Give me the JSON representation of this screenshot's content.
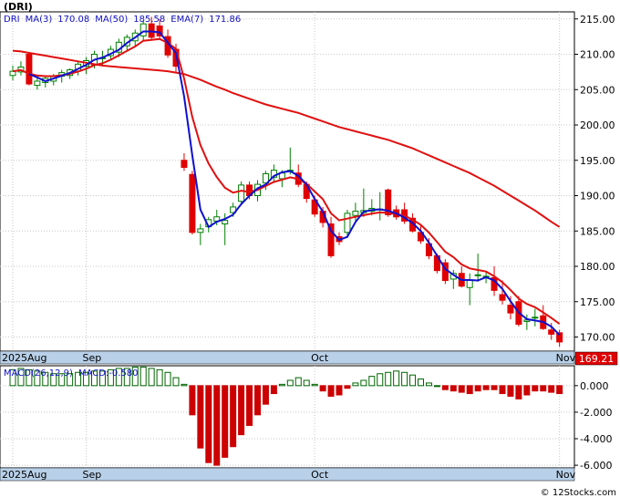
{
  "header": {
    "ticker_title": "(DRI)"
  },
  "legend_price": [
    {
      "text": "DRI",
      "color": "#1010c0"
    },
    {
      "text": "MA(3)",
      "color": "#1010c0"
    },
    {
      "text": "170.08",
      "color": "#1010c0"
    },
    {
      "text": "MA(50)",
      "color": "#1010c0"
    },
    {
      "text": "185.58",
      "color": "#1010c0"
    },
    {
      "text": "EMA(7)",
      "color": "#1010c0"
    },
    {
      "text": "171.86",
      "color": "#1010c0"
    }
  ],
  "legend_macd": [
    {
      "text": "MACD(26,12,9)",
      "color": "#1010c0"
    },
    {
      "text": "MACD:-0.580",
      "color": "#1010c0"
    }
  ],
  "last_price_label": "169.21",
  "watermark": "© 12Stocks.com",
  "colors": {
    "up": "#008000",
    "down": "#e00000",
    "ma3": "#1010d0",
    "ma50": "#e01010",
    "ema7": "#e01010",
    "hist": "#cc0000",
    "hist_up": "#006400",
    "axisbar": "#b8d0e8"
  },
  "chart_data": [
    {
      "type": "candlestick",
      "title": "DRI",
      "ylim": [
        168,
        216
      ],
      "yticks": [
        170,
        175,
        180,
        185,
        190,
        195,
        200,
        205,
        210,
        215
      ],
      "ytick_labels": [
        "170.00",
        "175.00",
        "180.00",
        "185.00",
        "190.00",
        "195.00",
        "200.00",
        "205.00",
        "210.00",
        "215.00"
      ],
      "xtick_labels": [
        {
          "label": "2025Aug",
          "bar": 0
        },
        {
          "label": "Sep",
          "bar": 9
        },
        {
          "label": "Oct",
          "bar": 37
        },
        {
          "label": "Nov",
          "bar": 67
        }
      ],
      "ohlc": [
        [
          207.0,
          208.4,
          206.3,
          207.6
        ],
        [
          207.5,
          209.0,
          207.0,
          208.2
        ],
        [
          210.0,
          210.2,
          205.6,
          205.8
        ],
        [
          205.6,
          206.8,
          205.0,
          206.2
        ],
        [
          206.0,
          207.0,
          205.3,
          206.6
        ],
        [
          206.2,
          207.2,
          205.6,
          206.9
        ],
        [
          206.9,
          207.8,
          206.0,
          207.4
        ],
        [
          207.0,
          208.0,
          206.5,
          207.8
        ],
        [
          207.6,
          209.0,
          207.0,
          208.6
        ],
        [
          208.3,
          209.6,
          207.2,
          209.1
        ],
        [
          208.5,
          210.5,
          208.0,
          210.0
        ],
        [
          209.5,
          210.5,
          208.5,
          209.5
        ],
        [
          209.8,
          211.2,
          209.2,
          210.7
        ],
        [
          210.3,
          212.2,
          209.6,
          211.7
        ],
        [
          211.2,
          212.8,
          210.5,
          212.4
        ],
        [
          211.9,
          213.5,
          211.0,
          213.0
        ],
        [
          212.6,
          214.8,
          212.0,
          214.3
        ],
        [
          214.3,
          215.3,
          212.0,
          212.4
        ],
        [
          214.0,
          215.0,
          212.0,
          212.6
        ],
        [
          212.5,
          213.5,
          209.5,
          209.9
        ],
        [
          210.7,
          211.5,
          207.5,
          208.3
        ],
        [
          195.0,
          196.0,
          193.5,
          194.0
        ],
        [
          193.0,
          193.5,
          184.5,
          184.8
        ],
        [
          184.8,
          186.0,
          183.0,
          185.3
        ],
        [
          185.6,
          187.0,
          184.8,
          186.6
        ],
        [
          186.4,
          188.0,
          185.8,
          187.0
        ],
        [
          186.0,
          187.5,
          183.0,
          186.5
        ],
        [
          187.6,
          189.0,
          187.0,
          188.4
        ],
        [
          189.2,
          192.0,
          188.8,
          191.5
        ],
        [
          191.5,
          192.0,
          189.5,
          190.0
        ],
        [
          190.0,
          192.2,
          189.2,
          191.6
        ],
        [
          191.8,
          193.5,
          190.8,
          193.1
        ],
        [
          192.6,
          194.4,
          191.8,
          193.6
        ],
        [
          192.4,
          193.6,
          191.2,
          193.2
        ],
        [
          193.5,
          196.8,
          193.0,
          193.6
        ],
        [
          193.2,
          194.4,
          191.2,
          191.6
        ],
        [
          191.6,
          192.0,
          189.0,
          189.6
        ],
        [
          189.4,
          190.0,
          187.0,
          187.4
        ],
        [
          187.8,
          188.4,
          185.5,
          186.2
        ],
        [
          186.0,
          187.0,
          181.2,
          181.5
        ],
        [
          184.2,
          184.8,
          183.0,
          183.5
        ],
        [
          184.8,
          188.0,
          184.0,
          187.5
        ],
        [
          187.2,
          189.0,
          186.2,
          187.8
        ],
        [
          187.6,
          191.0,
          187.0,
          187.9
        ],
        [
          187.8,
          189.5,
          187.2,
          188.2
        ],
        [
          188.0,
          190.5,
          186.5,
          188.1
        ],
        [
          190.8,
          191.0,
          187.0,
          187.3
        ],
        [
          188.0,
          188.6,
          186.6,
          187.0
        ],
        [
          188.0,
          189.0,
          186.0,
          186.4
        ],
        [
          186.8,
          187.5,
          184.8,
          185.0
        ],
        [
          184.8,
          185.8,
          183.2,
          183.6
        ],
        [
          183.2,
          184.0,
          181.0,
          181.5
        ],
        [
          181.5,
          181.8,
          179.0,
          179.4
        ],
        [
          180.5,
          181.0,
          177.5,
          178.0
        ],
        [
          178.2,
          179.5,
          176.8,
          179.0
        ],
        [
          179.0,
          180.0,
          177.0,
          177.2
        ],
        [
          177.0,
          179.0,
          174.5,
          178.0
        ],
        [
          178.8,
          181.8,
          177.8,
          178.8
        ],
        [
          178.6,
          179.2,
          177.6,
          178.6
        ],
        [
          178.4,
          180.0,
          175.8,
          176.6
        ],
        [
          176.0,
          178.0,
          174.6,
          175.2
        ],
        [
          174.5,
          175.8,
          172.5,
          173.4
        ],
        [
          175.0,
          175.8,
          171.5,
          171.8
        ],
        [
          172.2,
          173.2,
          171.0,
          172.4
        ],
        [
          172.7,
          174.0,
          171.5,
          172.8
        ],
        [
          173.0,
          174.5,
          171.0,
          171.2
        ],
        [
          171.0,
          172.0,
          169.6,
          170.4
        ],
        [
          170.6,
          171.0,
          168.6,
          169.3
        ]
      ],
      "series": [
        {
          "name": "MA(3)",
          "values": [
            null,
            null,
            207.2,
            206.73,
            206.2,
            206.57,
            206.97,
            207.37,
            207.93,
            208.5,
            209.23,
            209.53,
            210.07,
            210.63,
            211.6,
            212.37,
            213.23,
            213.23,
            213.1,
            211.63,
            210.2,
            204.07,
            195.7,
            188.03,
            185.57,
            186.3,
            186.7,
            187.3,
            188.8,
            189.97,
            191.03,
            191.57,
            192.77,
            193.3,
            193.47,
            192.8,
            191.6,
            189.53,
            187.73,
            185.03,
            183.73,
            184.17,
            186.27,
            187.73,
            187.97,
            188.07,
            187.87,
            187.47,
            186.9,
            186.13,
            185.0,
            183.37,
            181.5,
            179.63,
            178.8,
            178.07,
            178.07,
            178.0,
            178.47,
            178.0,
            176.8,
            175.07,
            173.47,
            172.53,
            172.33,
            172.13,
            171.47,
            170.3
          ]
        },
        {
          "name": "EMA(7)",
          "values": [
            207.6,
            207.75,
            207.26,
            207.0,
            206.9,
            206.9,
            207.03,
            207.22,
            207.56,
            207.94,
            208.45,
            208.72,
            209.22,
            209.84,
            210.48,
            211.11,
            211.91,
            212.03,
            212.17,
            211.6,
            210.77,
            206.58,
            201.13,
            197.17,
            194.53,
            192.65,
            191.11,
            190.43,
            190.7,
            190.53,
            190.8,
            191.38,
            191.94,
            192.25,
            192.59,
            192.34,
            191.66,
            190.6,
            189.5,
            187.5,
            186.5,
            186.75,
            187.01,
            187.23,
            187.47,
            187.63,
            187.55,
            187.41,
            187.16,
            186.62,
            185.87,
            184.78,
            183.43,
            182.07,
            181.3,
            180.27,
            179.7,
            179.48,
            179.26,
            178.6,
            177.75,
            176.66,
            175.45,
            174.69,
            174.22,
            173.47,
            172.7,
            171.86
          ]
        },
        {
          "name": "MA(50)",
          "values": [
            210.5,
            210.4,
            210.2,
            210.0,
            209.8,
            209.6,
            209.4,
            209.2,
            209.0,
            208.8,
            208.6,
            208.4,
            208.3,
            208.2,
            208.1,
            208.0,
            207.9,
            207.8,
            207.7,
            207.6,
            207.4,
            207.2,
            206.8,
            206.4,
            205.9,
            205.4,
            205.0,
            204.5,
            204.1,
            203.7,
            203.3,
            202.9,
            202.6,
            202.3,
            202.0,
            201.7,
            201.3,
            200.9,
            200.5,
            200.1,
            199.7,
            199.4,
            199.1,
            198.8,
            198.5,
            198.2,
            197.9,
            197.5,
            197.1,
            196.7,
            196.2,
            195.7,
            195.2,
            194.7,
            194.2,
            193.7,
            193.2,
            192.6,
            192.0,
            191.4,
            190.7,
            190.0,
            189.3,
            188.6,
            187.9,
            187.1,
            186.3,
            185.58
          ]
        }
      ]
    },
    {
      "type": "histogram",
      "title": "MACD(26,12,9)",
      "ylim": [
        -6.2,
        1.5
      ],
      "yticks": [
        0,
        -2,
        -4,
        -6
      ],
      "ytick_labels": [
        "0.000",
        "-2.000",
        "-4.000",
        "-6.000"
      ],
      "xtick_labels": [
        {
          "label": "2025Aug",
          "bar": 0
        },
        {
          "label": "Sep",
          "bar": 9
        },
        {
          "label": "Oct",
          "bar": 37
        },
        {
          "label": "Nov",
          "bar": 67
        }
      ],
      "values": [
        1.2,
        1.3,
        1.2,
        1.1,
        1.0,
        0.9,
        0.9,
        0.9,
        1.0,
        1.0,
        1.1,
        1.1,
        1.2,
        1.3,
        1.3,
        1.4,
        1.4,
        1.3,
        1.2,
        1.0,
        0.6,
        0.1,
        -2.2,
        -4.7,
        -5.8,
        -6.0,
        -5.4,
        -4.6,
        -3.7,
        -3.0,
        -2.2,
        -1.4,
        -0.6,
        0.1,
        0.4,
        0.6,
        0.4,
        0.1,
        -0.4,
        -0.8,
        -0.7,
        -0.2,
        0.2,
        0.4,
        0.7,
        0.9,
        1.0,
        1.1,
        1.0,
        0.8,
        0.5,
        0.2,
        0.0,
        -0.3,
        -0.4,
        -0.5,
        -0.6,
        -0.4,
        -0.3,
        -0.3,
        -0.6,
        -0.8,
        -1.0,
        -0.7,
        -0.4,
        -0.4,
        -0.5,
        -0.6
      ]
    }
  ]
}
